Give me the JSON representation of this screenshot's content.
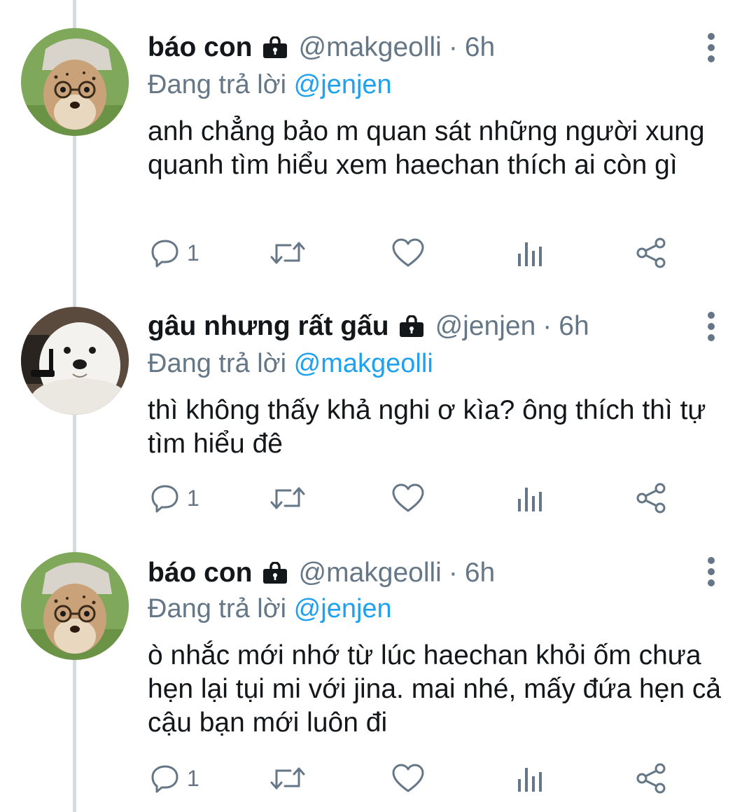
{
  "tweets": [
    {
      "display_name": "báo con",
      "handle": "@makgeolli",
      "separator": "·",
      "time": "6h",
      "reply_prefix": "Đang trả lời",
      "reply_handle": "@jenjen",
      "text": "anh chẳng bảo m quan sát những người xung quanh tìm hiểu xem haechan thích ai còn gì",
      "reply_count": "1",
      "avatar": "cheetah-cub-avatar"
    },
    {
      "display_name": "gâu nhưng rất gấu",
      "handle": "@jenjen",
      "separator": "·",
      "time": "6h",
      "reply_prefix": "Đang trả lời",
      "reply_handle": "@makgeolli",
      "text": "thì không thấy khả nghi ơ kìa? ông thích thì tự tìm hiểu đê",
      "reply_count": "1",
      "avatar": "white-dog-avatar"
    },
    {
      "display_name": "báo con",
      "handle": "@makgeolli",
      "separator": "·",
      "time": "6h",
      "reply_prefix": "Đang trả lời",
      "reply_handle": "@jenjen",
      "text": "ò nhắc mới nhớ từ lúc haechan khỏi ốm chưa hẹn lại tụi mi với jina. mai nhé, mấy đứa hẹn cả cậu bạn mới luôn đi",
      "reply_count": "1",
      "avatar": "cheetah-cub-avatar"
    }
  ],
  "colors": {
    "text": "#14171a",
    "secondary": "#657786",
    "link": "#1da1f2",
    "thread_line": "#d6dbdf"
  },
  "icons": [
    "lock-icon",
    "more-vertical-icon",
    "reply-icon",
    "retweet-icon",
    "like-icon",
    "analytics-icon",
    "share-icon"
  ]
}
